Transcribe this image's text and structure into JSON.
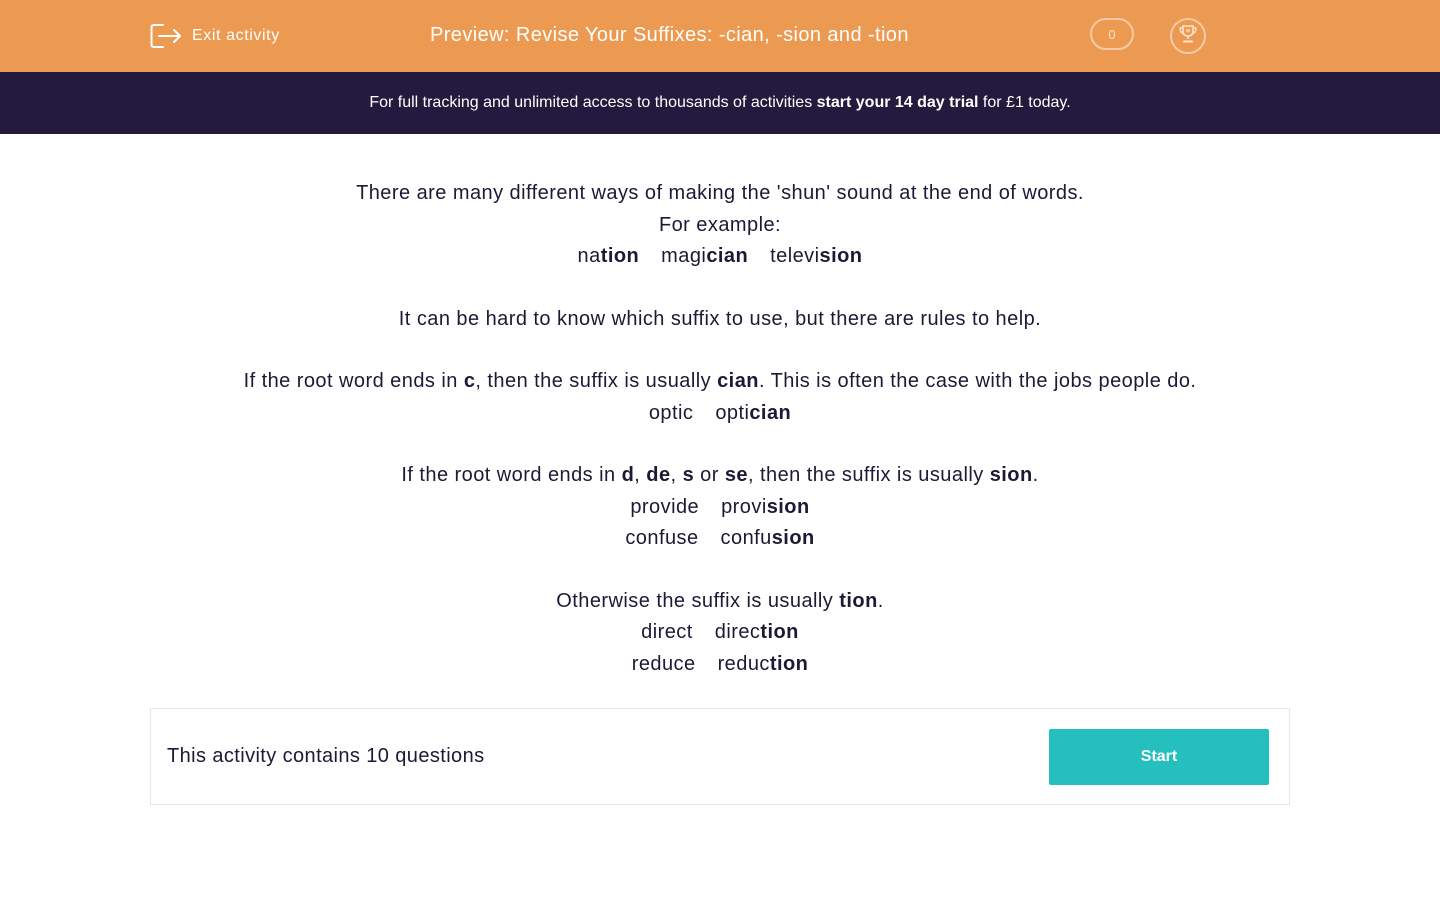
{
  "header": {
    "exit_label": "Exit activity",
    "title": "Preview: Revise Your Suffixes: -cian, -sion and -tion",
    "score": "0",
    "bg_color": "#ec9a51"
  },
  "promo": {
    "text_before": "For full tracking and unlimited access to thousands of activities ",
    "text_bold": "start your 14 day trial",
    "text_after": " for £1 today.",
    "bg_color": "#241a3d"
  },
  "content": {
    "intro": "There are many different ways of making the 'shun' sound at the end of words.",
    "for_example": "For example:",
    "examples": [
      {
        "root": "na",
        "suffix": "tion"
      },
      {
        "root": "magi",
        "suffix": "cian"
      },
      {
        "root": "televi",
        "suffix": "sion"
      }
    ],
    "rules_intro": "It can be hard to know which suffix to use, but there are rules to help.",
    "rule_cian": {
      "p1": "If the root word ends in ",
      "b1": "c",
      "p2": ", then the suffix is usually ",
      "b2": "cian",
      "p3": ". This is often the case with the jobs people do.",
      "pairs": [
        {
          "word": "optic",
          "root": "opti",
          "suffix": "cian"
        }
      ]
    },
    "rule_sion": {
      "p1": "If the root word ends in ",
      "b1": "d",
      "p2": ", ",
      "b2": "de",
      "p3": ", ",
      "b3": "s",
      "p4": " or ",
      "b4": "se",
      "p5": ", then the suffix is usually ",
      "b5": "sion",
      "p6": ".",
      "pairs": [
        {
          "word": "provide",
          "root": "provi",
          "suffix": "sion"
        },
        {
          "word": "confuse",
          "root": "confu",
          "suffix": "sion"
        }
      ]
    },
    "rule_tion": {
      "p1": "Otherwise the suffix is usually ",
      "b1": "tion",
      "p2": ".",
      "pairs": [
        {
          "word": "direct",
          "root": "direc",
          "suffix": "tion"
        },
        {
          "word": "reduce",
          "root": "reduc",
          "suffix": "tion"
        }
      ]
    }
  },
  "footer": {
    "question_count": "This activity contains 10 questions",
    "start_label": "Start",
    "accent_color": "#25bfbe"
  }
}
